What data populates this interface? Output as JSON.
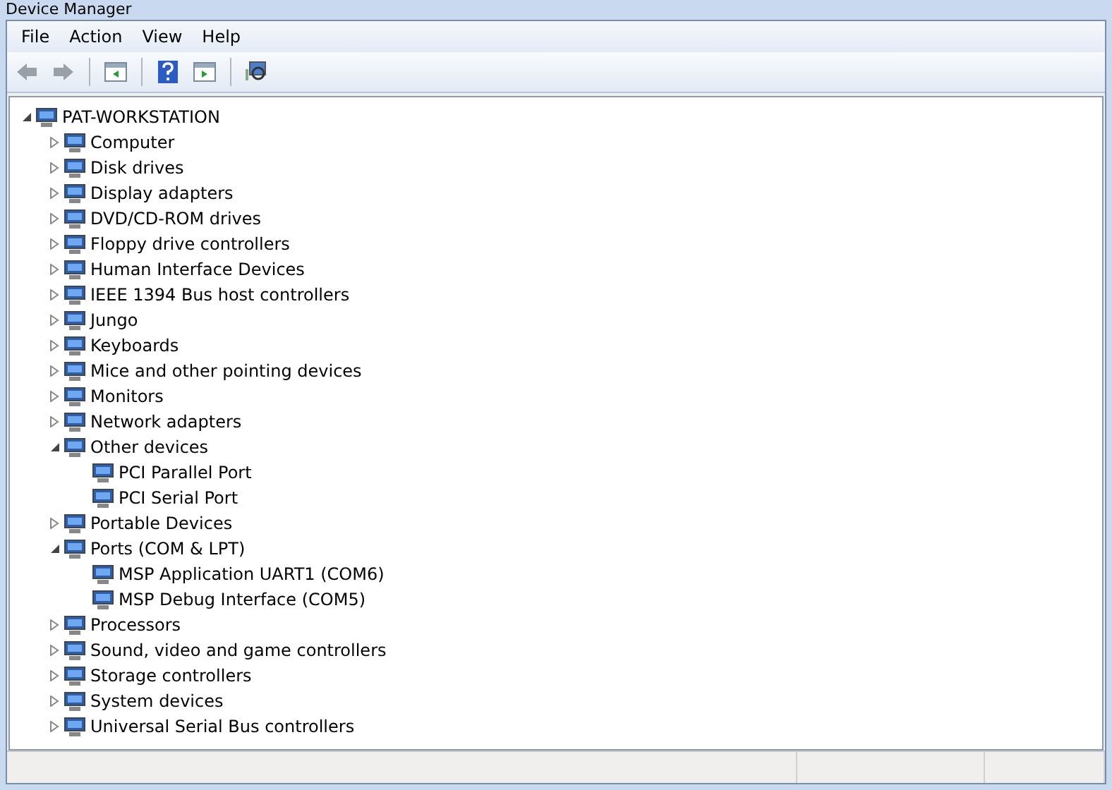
{
  "window": {
    "title": "Device Manager"
  },
  "menu": [
    "File",
    "Action",
    "View",
    "Help"
  ],
  "tree": [
    {
      "label": "PAT-WORKSTATION",
      "expanded": true,
      "children": [
        {
          "label": "Computer",
          "expanded": false
        },
        {
          "label": "Disk drives",
          "expanded": false
        },
        {
          "label": "Display adapters",
          "expanded": false
        },
        {
          "label": "DVD/CD-ROM drives",
          "expanded": false
        },
        {
          "label": "Floppy drive controllers",
          "expanded": false
        },
        {
          "label": "Human Interface Devices",
          "expanded": false
        },
        {
          "label": "IEEE 1394 Bus host controllers",
          "expanded": false
        },
        {
          "label": "Jungo",
          "expanded": false
        },
        {
          "label": "Keyboards",
          "expanded": false
        },
        {
          "label": "Mice and other pointing devices",
          "expanded": false
        },
        {
          "label": "Monitors",
          "expanded": false
        },
        {
          "label": "Network adapters",
          "expanded": false
        },
        {
          "label": "Other devices",
          "expanded": true,
          "children": [
            {
              "label": "PCI Parallel Port"
            },
            {
              "label": "PCI Serial Port"
            }
          ]
        },
        {
          "label": "Portable Devices",
          "expanded": false
        },
        {
          "label": "Ports (COM & LPT)",
          "expanded": true,
          "children": [
            {
              "label": "MSP Application UART1 (COM6)"
            },
            {
              "label": "MSP Debug Interface (COM5)"
            }
          ]
        },
        {
          "label": "Processors",
          "expanded": false
        },
        {
          "label": "Sound, video and game controllers",
          "expanded": false
        },
        {
          "label": "Storage controllers",
          "expanded": false
        },
        {
          "label": "System devices",
          "expanded": false
        },
        {
          "label": "Universal Serial Bus controllers",
          "expanded": false
        }
      ]
    }
  ]
}
